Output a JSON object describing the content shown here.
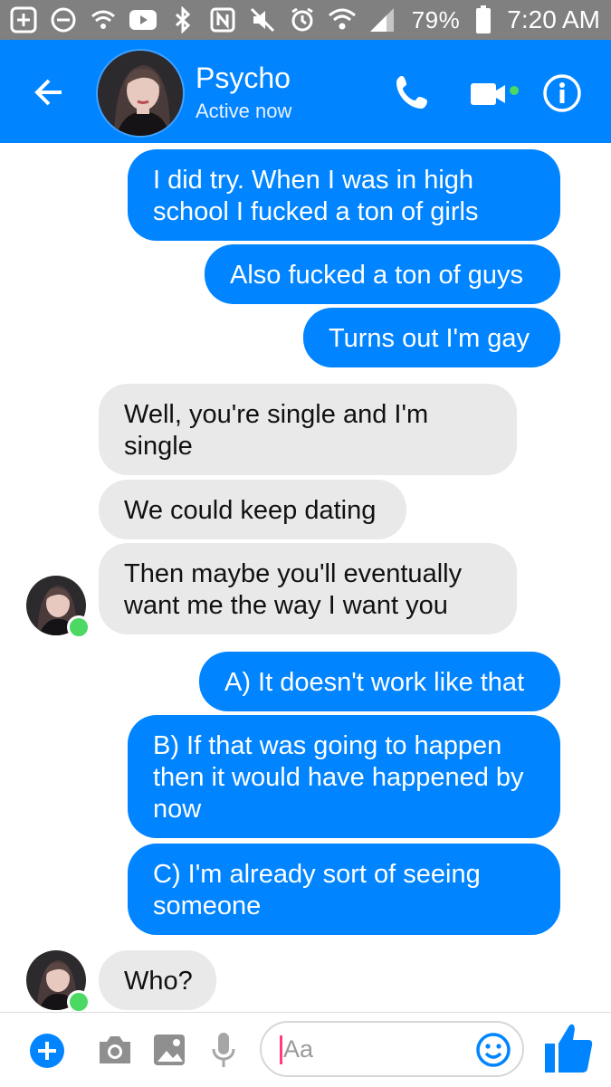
{
  "status_bar": {
    "battery": "79%",
    "time": "7:20 AM"
  },
  "header": {
    "contact_name": "Psycho",
    "contact_status": "Active now"
  },
  "messages": [
    {
      "side": "out",
      "text_lines": [
        "I did try. When I was in high",
        "school I fucked a ton of girls"
      ]
    },
    {
      "side": "out",
      "text_lines": [
        "Also fucked a ton of guys"
      ]
    },
    {
      "side": "out",
      "text_lines": [
        "Turns out I'm gay"
      ]
    },
    {
      "side": "in",
      "text_lines": [
        "Well, you're single and I'm",
        "single"
      ]
    },
    {
      "side": "in",
      "text_lines": [
        "We could keep dating"
      ]
    },
    {
      "side": "in",
      "text_lines": [
        "Then maybe you'll eventually",
        "want me the way I want you"
      ]
    },
    {
      "side": "out",
      "text_lines": [
        "A) It doesn't work like that"
      ]
    },
    {
      "side": "out",
      "text_lines": [
        "B) If that was going to happen",
        "then it would have happened by",
        "now"
      ]
    },
    {
      "side": "out",
      "text_lines": [
        "C) I'm already sort of seeing",
        "someone"
      ]
    },
    {
      "side": "in",
      "text_lines": [
        "Who?"
      ]
    }
  ],
  "composer": {
    "placeholder": "Aa"
  },
  "colors": {
    "accent": "#0084ff",
    "incoming_bubble": "#e9e9ea",
    "status_bar": "#808080",
    "online": "#4bd964"
  }
}
